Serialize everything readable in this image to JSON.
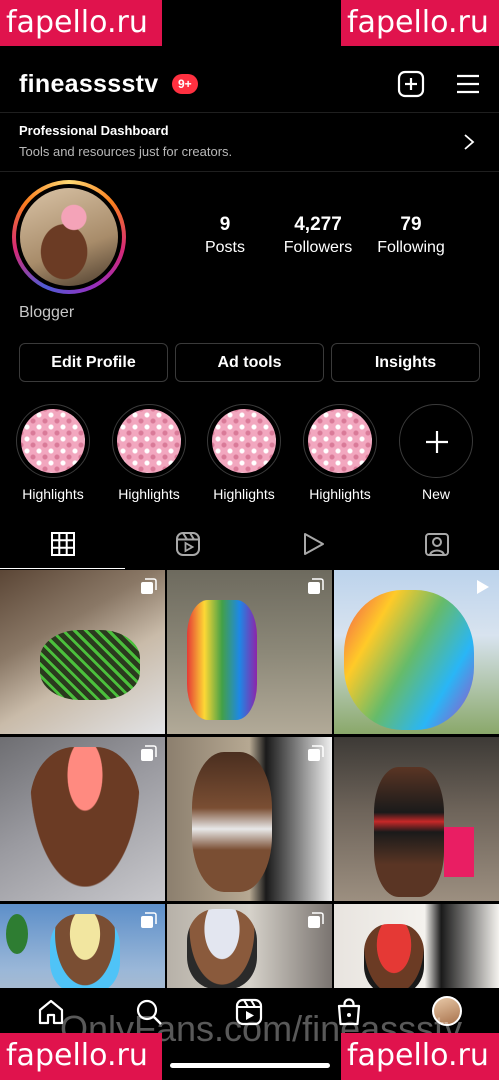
{
  "watermarks": {
    "top_left": "fapello.ru",
    "top_right": "fapello.ru",
    "bottom_left": "fapello.ru",
    "bottom_right": "fapello.ru",
    "bottom_center": "OnlyFans.com/fineassstv"
  },
  "header": {
    "username": "fineasssstv",
    "notification_badge": "9+",
    "create_icon": "plus-square-icon",
    "menu_icon": "hamburger-menu-icon"
  },
  "dashboard": {
    "title": "Professional Dashboard",
    "subtitle": "Tools and resources just for creators.",
    "icon": "chevron-right-icon"
  },
  "profile": {
    "stats": [
      {
        "value": "9",
        "label": "Posts"
      },
      {
        "value": "4,277",
        "label": "Followers"
      },
      {
        "value": "79",
        "label": "Following"
      }
    ],
    "bio": "Blogger"
  },
  "buttons": {
    "edit_profile": "Edit Profile",
    "ad_tools": "Ad tools",
    "insights": "Insights"
  },
  "highlights": [
    {
      "label": "Highlights"
    },
    {
      "label": "Highlights"
    },
    {
      "label": "Highlights"
    },
    {
      "label": "Highlights"
    },
    {
      "label": "New"
    }
  ],
  "tabs": [
    "grid-icon",
    "reels-icon",
    "play-icon",
    "tagged-icon"
  ],
  "colors": {
    "background": "#000000",
    "notification": "#ff3040",
    "watermark": "#e0134d"
  },
  "bottom_nav": [
    "home-icon",
    "search-icon",
    "reels-icon",
    "shop-icon",
    "profile-avatar"
  ]
}
